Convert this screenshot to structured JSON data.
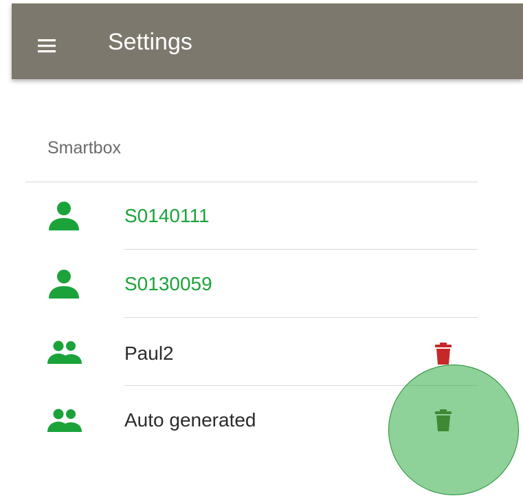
{
  "app_bar": {
    "title": "Settings",
    "menu_icon": "hamburger-menu-icon",
    "background": "#7d786d"
  },
  "section": {
    "title": "Smartbox"
  },
  "items": [
    {
      "label": "S0140111",
      "icon": "person-icon",
      "label_color": "#1ba33a",
      "deletable": false
    },
    {
      "label": "S0130059",
      "icon": "person-icon",
      "label_color": "#1ba33a",
      "deletable": false
    },
    {
      "label": "Paul2",
      "icon": "people-icon",
      "label_color": "#2b2b2b",
      "deletable": true,
      "delete_icon_color": "#c62828"
    },
    {
      "label": "Auto generated",
      "icon": "people-icon",
      "label_color": "#2b2b2b",
      "deletable": true,
      "delete_icon_color": "#5d6a2c",
      "pressed": true
    }
  ],
  "colors": {
    "accent_green": "#1ba33a",
    "delete_red": "#c62828",
    "ripple_green": "#26a63c"
  }
}
